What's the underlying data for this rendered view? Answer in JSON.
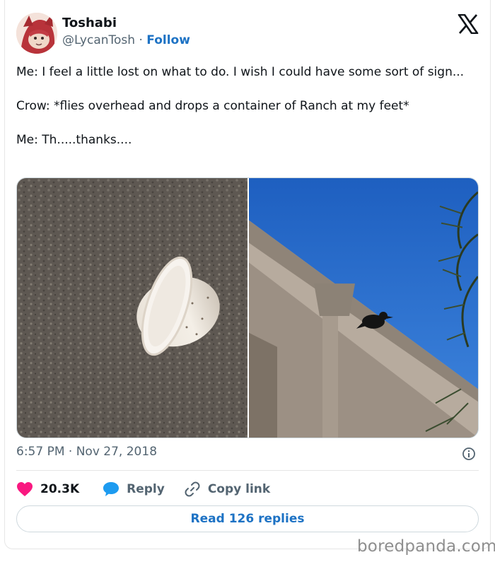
{
  "user": {
    "name": "Toshabi",
    "handle": "@LycanTosh",
    "separator": "·",
    "follow_label": "Follow"
  },
  "tweet": {
    "lines": [
      "Me: I feel a little lost on what to do. I wish I could have some sort of sign...",
      "Crow: *flies overhead and drops a container of Ranch at my feet*",
      "Me: Th.....thanks...."
    ],
    "time": "6:57 PM",
    "date": "Nov 27, 2018",
    "dot": "·"
  },
  "media": [
    {
      "icon": "ranch-cup-photo"
    },
    {
      "icon": "crow-on-roof-photo"
    }
  ],
  "actions": {
    "likes": "20.3K",
    "reply_label": "Reply",
    "copy_label": "Copy link",
    "read_replies_label": "Read 126 replies"
  },
  "colors": {
    "link": "#1d72c4",
    "like": "#f91880",
    "reply": "#1d9bf0",
    "muted": "#536471"
  },
  "watermark": "boredpanda.com"
}
